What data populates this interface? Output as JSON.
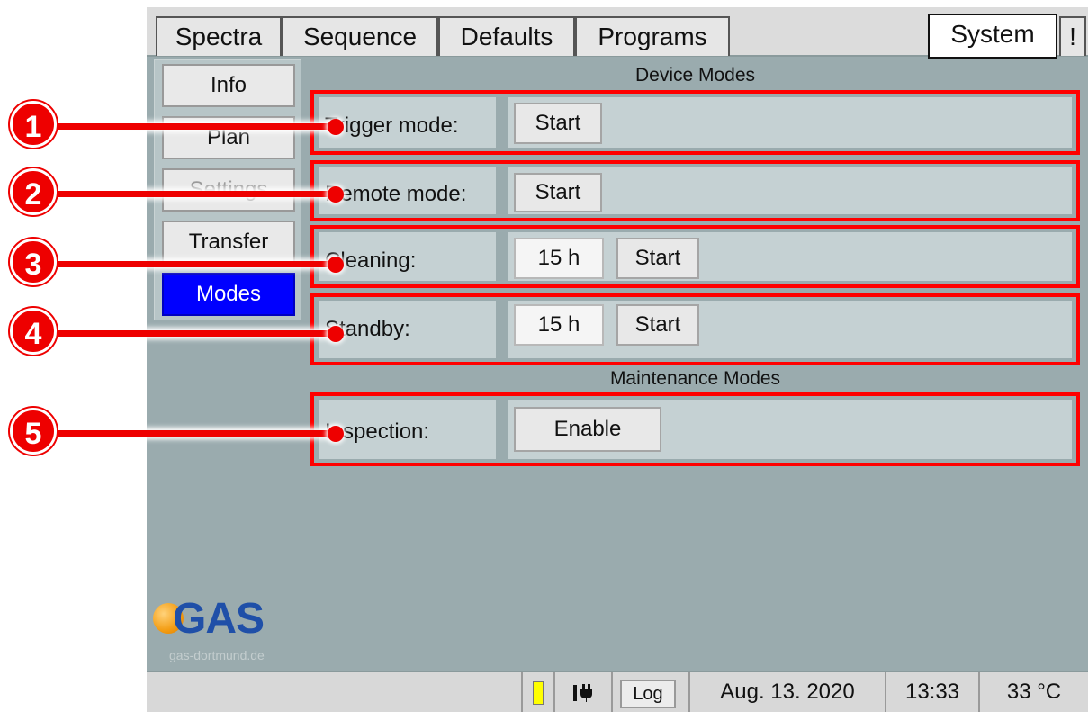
{
  "tabs": [
    {
      "label": "Spectra"
    },
    {
      "label": "Sequence"
    },
    {
      "label": "Defaults"
    },
    {
      "label": "Programs"
    }
  ],
  "system_tab": {
    "label": "System"
  },
  "alert_tab": {
    "label": "!"
  },
  "sidebar": {
    "items": [
      {
        "label": "Info",
        "state": "normal"
      },
      {
        "label": "Plan",
        "state": "normal"
      },
      {
        "label": "Settings",
        "state": "disabled"
      },
      {
        "label": "Transfer",
        "state": "normal"
      },
      {
        "label": "Modes",
        "state": "active"
      }
    ]
  },
  "device_modes": {
    "title": "Device Modes",
    "rows": [
      {
        "label": "Trigger mode:",
        "button": "Start"
      },
      {
        "label": "Remote mode:",
        "button": "Start"
      },
      {
        "label": "Cleaning:",
        "value": "15 h",
        "button": "Start"
      },
      {
        "label": "Standby:",
        "value": "15 h",
        "button": "Start"
      }
    ]
  },
  "maintenance_modes": {
    "title": "Maintenance Modes",
    "rows": [
      {
        "label": "Inspection:",
        "button": "Enable"
      }
    ]
  },
  "callouts": [
    "1",
    "2",
    "3",
    "4",
    "5"
  ],
  "logo": {
    "text": "GAS",
    "url": "gas-dortmund.de"
  },
  "statusbar": {
    "log_label": "Log",
    "date": "Aug. 13. 2020",
    "time": "13:33",
    "temperature": "33 °C",
    "indicator_icon": "yellow-status-indicator",
    "power_icon": "power-plug-icon"
  },
  "colors": {
    "highlight": "#ff0000",
    "active_nav": "#0000ff",
    "panel": "#9aabae",
    "logo_blue": "#1f4fa8",
    "logo_orange": "#f39c12"
  }
}
